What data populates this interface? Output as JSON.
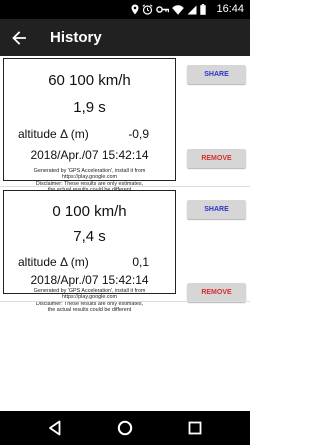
{
  "status_bar": {
    "time": "16:44",
    "icons": [
      "location-icon",
      "alarm-icon",
      "vpn-key-icon",
      "wifi-icon",
      "signal-icon",
      "battery-icon"
    ]
  },
  "app_bar": {
    "title": "History",
    "back_icon": "arrow-left-icon"
  },
  "entries": [
    {
      "speed_range": "60 100 km/h",
      "time": "1,9 s",
      "altitude_label": "altitude Δ (m)",
      "altitude_value": "-0,9",
      "datetime": "2018/Apr./07 15:42:14",
      "disclaimer_line1": "Generated by 'GPS Acceleration', install it from https://play.google.com",
      "disclaimer_line2": "Disclaimer: These results are only estimates,",
      "disclaimer_line3": "the actual results could be different",
      "share_label": "SHARE",
      "remove_label": "REMOVE"
    },
    {
      "speed_range": "0 100 km/h",
      "time": "7,4 s",
      "altitude_label": "altitude Δ (m)",
      "altitude_value": "0,1",
      "datetime": "2018/Apr./07 15:42:14",
      "disclaimer_line1": "Generated by 'GPS Acceleration', install it from https://play.google.com",
      "disclaimer_line2": "Disclaimer: These results are only estimates,",
      "disclaimer_line3": "the actual results could be different",
      "share_label": "SHARE",
      "remove_label": "REMOVE"
    }
  ],
  "nav_bar": {
    "icons": [
      "back-triangle-icon",
      "home-circle-icon",
      "recents-square-icon"
    ]
  },
  "colors": {
    "app_bar": "#212121",
    "share_text": "#2a33c9",
    "remove_text": "#d32f2f",
    "button_bg": "#d6d6d6"
  }
}
